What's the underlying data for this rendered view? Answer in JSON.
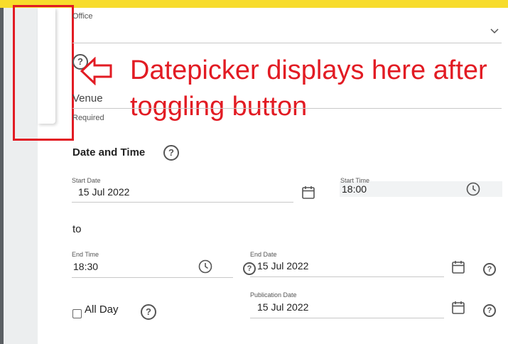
{
  "office": {
    "label": "Office"
  },
  "venue": {
    "placeholder": "Venue",
    "hint": "Required"
  },
  "annotation": {
    "text": "Datepicker displays here after toggling button"
  },
  "date_time": {
    "title": "Date and Time",
    "help_glyph": "?",
    "start_date": {
      "label": "Start Date",
      "value": "15 Jul 2022"
    },
    "start_time": {
      "label": "Start Time",
      "value": "18:00"
    },
    "to_text": "to",
    "end_time": {
      "label": "End Time",
      "value": "18:30"
    },
    "end_date": {
      "label": "End Date",
      "value": "15 Jul 2022"
    },
    "all_day": {
      "label": "All Day",
      "checked": false
    },
    "publication_date": {
      "label": "Publication Date",
      "value": "15 Jul 2022"
    }
  },
  "icons": {
    "office_dropdown": "chevron-down-icon",
    "calendar": "calendar-icon",
    "clock": "clock-icon",
    "help": "help-icon",
    "annotation_arrow": "arrow-left-icon"
  },
  "colors": {
    "top_bar": "#f7dc2c",
    "annotation": "#e21b23",
    "left_strip": "#5b5f63",
    "gray_area": "#eceeef"
  }
}
